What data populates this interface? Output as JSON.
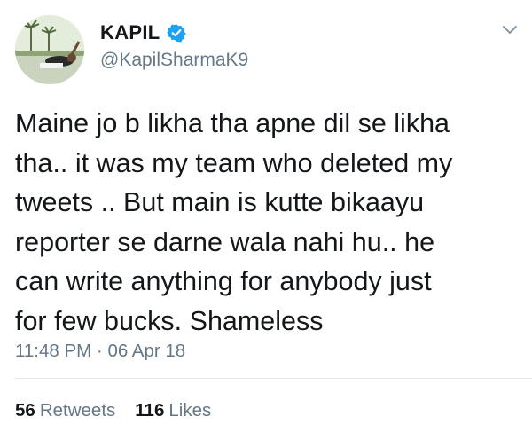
{
  "tweet": {
    "author": {
      "name": "KAPIL",
      "handle": "@KapilSharmaK9",
      "verified": true
    },
    "text": "Maine jo b likha tha apne dil se likha\ntha.. it was my team who deleted my\ntweets .. But main is kutte bikaayu\nreporter se darne wala nahi hu.. he\ncan write anything for anybody just\nfor few bucks. Shameless",
    "timestamp": "11:48 PM · 06 Apr 18",
    "stats": {
      "retweets_count": "56",
      "retweets_label": "Retweets",
      "likes_count": "116",
      "likes_label": "Likes"
    }
  },
  "colors": {
    "text": "#14171a",
    "secondary": "#657786",
    "verified_blue": "#1da1f2",
    "divider": "#e1e8ed"
  },
  "icons": {
    "verified": "verified-badge-icon",
    "more": "chevron-down-icon"
  }
}
